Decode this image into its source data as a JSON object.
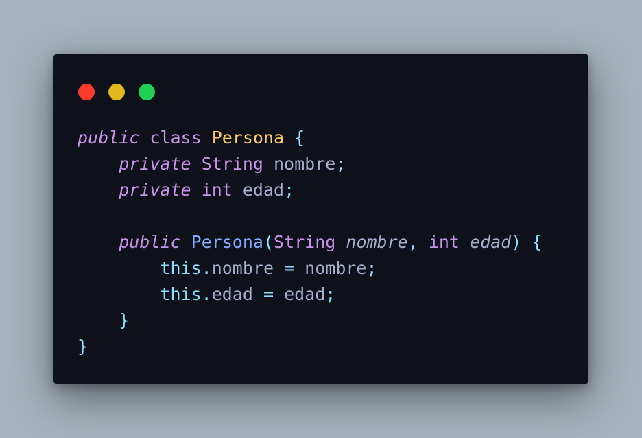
{
  "window": {
    "controls": [
      {
        "name": "close",
        "color": "#ff3b2f"
      },
      {
        "name": "minimize",
        "color": "#e1b81c"
      },
      {
        "name": "maximize",
        "color": "#21cf54"
      }
    ]
  },
  "code": {
    "language": "java",
    "lines": [
      [
        {
          "t": "public",
          "c": "kw it"
        },
        {
          "t": " ",
          "c": "plain"
        },
        {
          "t": "class",
          "c": "kw"
        },
        {
          "t": " ",
          "c": "plain"
        },
        {
          "t": "Persona",
          "c": "cls"
        },
        {
          "t": " ",
          "c": "plain"
        },
        {
          "t": "{",
          "c": "punc"
        }
      ],
      [
        {
          "t": "    ",
          "c": "plain"
        },
        {
          "t": "private",
          "c": "kw it"
        },
        {
          "t": " ",
          "c": "plain"
        },
        {
          "t": "String",
          "c": "kw"
        },
        {
          "t": " nombre",
          "c": "plain"
        },
        {
          "t": ";",
          "c": "punc"
        }
      ],
      [
        {
          "t": "    ",
          "c": "plain"
        },
        {
          "t": "private",
          "c": "kw it"
        },
        {
          "t": " ",
          "c": "plain"
        },
        {
          "t": "int",
          "c": "kw"
        },
        {
          "t": " edad",
          "c": "plain"
        },
        {
          "t": ";",
          "c": "punc"
        }
      ],
      [],
      [
        {
          "t": "    ",
          "c": "plain"
        },
        {
          "t": "public",
          "c": "kw it"
        },
        {
          "t": " ",
          "c": "plain"
        },
        {
          "t": "Persona",
          "c": "fn"
        },
        {
          "t": "(",
          "c": "punc"
        },
        {
          "t": "String",
          "c": "kw"
        },
        {
          "t": " ",
          "c": "plain"
        },
        {
          "t": "nombre",
          "c": "plain it"
        },
        {
          "t": ", ",
          "c": "punc"
        },
        {
          "t": "int",
          "c": "kw"
        },
        {
          "t": " ",
          "c": "plain"
        },
        {
          "t": "edad",
          "c": "plain it"
        },
        {
          "t": ")",
          "c": "punc"
        },
        {
          "t": " ",
          "c": "plain"
        },
        {
          "t": "{",
          "c": "punc"
        }
      ],
      [
        {
          "t": "        ",
          "c": "plain"
        },
        {
          "t": "this",
          "c": "this"
        },
        {
          "t": ".",
          "c": "punc"
        },
        {
          "t": "nombre ",
          "c": "plain"
        },
        {
          "t": "=",
          "c": "punc"
        },
        {
          "t": " nombre",
          "c": "plain"
        },
        {
          "t": ";",
          "c": "punc"
        }
      ],
      [
        {
          "t": "        ",
          "c": "plain"
        },
        {
          "t": "this",
          "c": "this"
        },
        {
          "t": ".",
          "c": "punc"
        },
        {
          "t": "edad ",
          "c": "plain"
        },
        {
          "t": "=",
          "c": "punc"
        },
        {
          "t": " edad",
          "c": "plain"
        },
        {
          "t": ";",
          "c": "punc"
        }
      ],
      [
        {
          "t": "    ",
          "c": "plain"
        },
        {
          "t": "}",
          "c": "punc"
        }
      ],
      [
        {
          "t": "}",
          "c": "punc"
        }
      ]
    ]
  }
}
